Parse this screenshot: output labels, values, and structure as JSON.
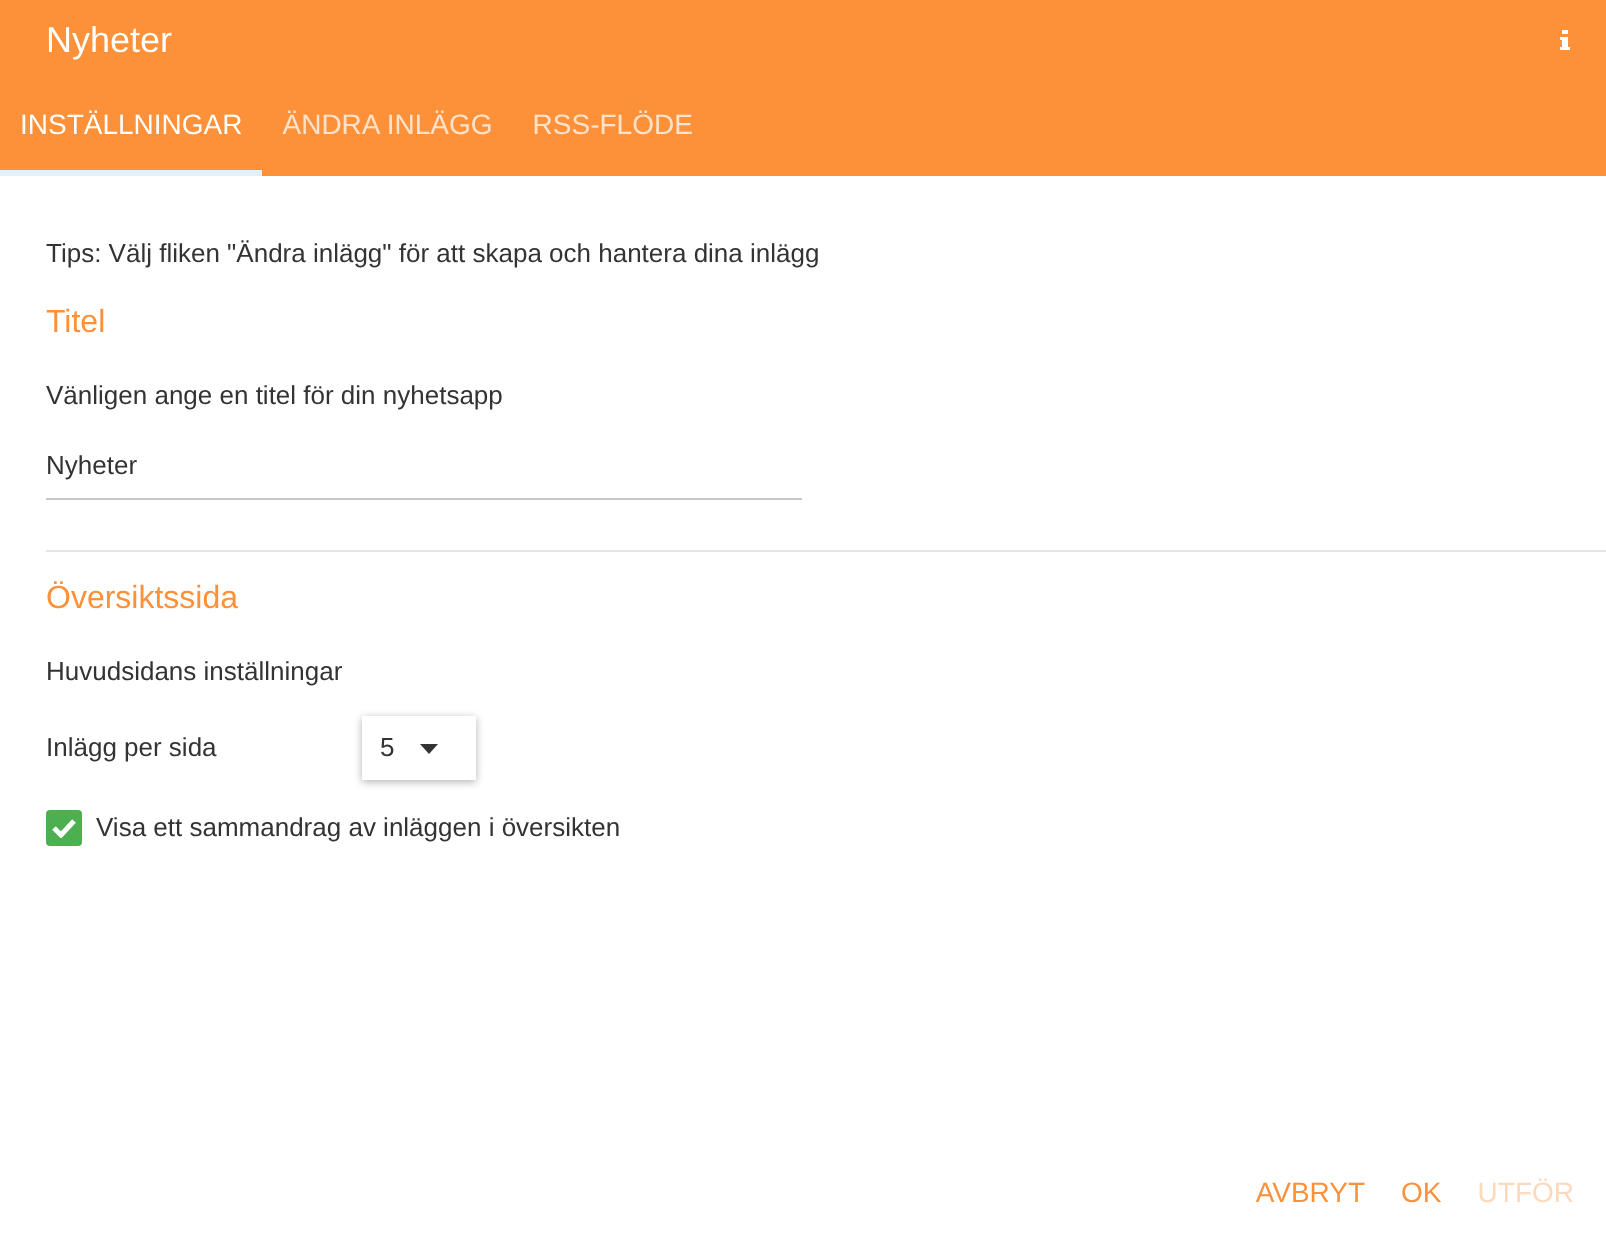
{
  "header": {
    "title": "Nyheter"
  },
  "tabs": [
    {
      "label": "INSTÄLLNINGAR",
      "selected": true
    },
    {
      "label": "ÄNDRA INLÄGG",
      "selected": false
    },
    {
      "label": "RSS-FLÖDE",
      "selected": false
    }
  ],
  "tip": "Tips: Välj fliken \"Ändra inlägg\" för att skapa och hantera dina inlägg",
  "title_section": {
    "heading": "Titel",
    "description": "Vänligen ange en titel för din nyhetsapp",
    "value": "Nyheter"
  },
  "overview_section": {
    "heading": "Översiktssida",
    "description": "Huvudsidans inställningar",
    "posts_per_page": {
      "label": "Inlägg per sida",
      "value": "5"
    },
    "summary": {
      "label": "Visa ett sammandrag av inläggen i översikten",
      "checked": true
    }
  },
  "buttons": [
    {
      "label": "AVBRYT",
      "disabled": false
    },
    {
      "label": "OK",
      "disabled": false
    },
    {
      "label": "UTFÖR",
      "disabled": true
    }
  ]
}
